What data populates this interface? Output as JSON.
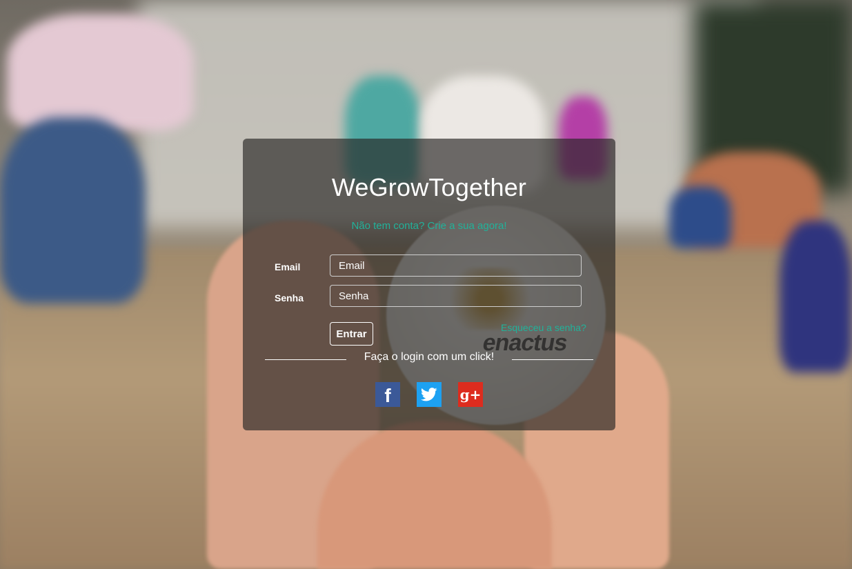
{
  "app": {
    "title": "WeGrowTogether",
    "signup_link": "Não tem conta? Crie a sua agora!"
  },
  "form": {
    "email_label": "Email",
    "email_placeholder": "Email",
    "password_label": "Senha",
    "password_placeholder": "Senha",
    "submit_label": "Entrar",
    "forgot_link": "Esqueceu a senha?"
  },
  "social": {
    "caption": "Faça o login com um click!",
    "providers": [
      {
        "name": "facebook",
        "icon": "facebook-icon",
        "color": "#3b5998"
      },
      {
        "name": "twitter",
        "icon": "twitter-icon",
        "color": "#1da1f2"
      },
      {
        "name": "google-plus",
        "icon": "google-plus-icon",
        "color": "#dd2c1e"
      }
    ]
  },
  "background": {
    "coin_brand": "enactus"
  },
  "colors": {
    "accent": "#21b29a",
    "card_bg": "rgba(40,38,36,0.66)"
  }
}
